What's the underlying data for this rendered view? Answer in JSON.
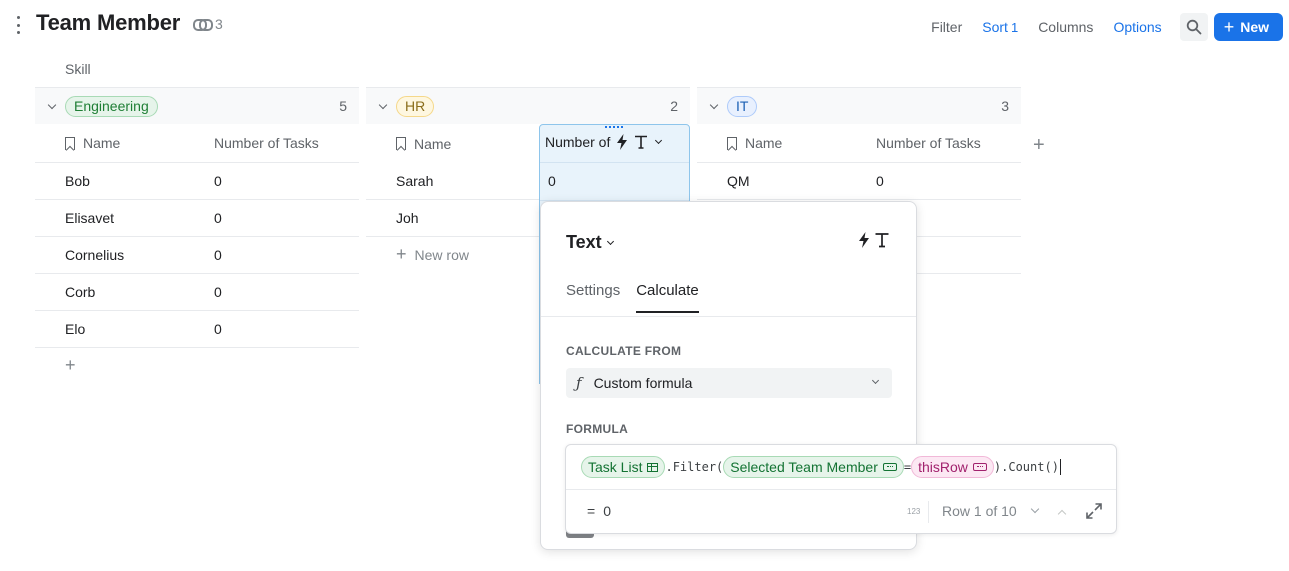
{
  "header": {
    "title": "Team Member",
    "link_count": "3",
    "filter_label": "Filter",
    "sort_label": "Sort",
    "sort_count": "1",
    "columns_label": "Columns",
    "options_label": "Options",
    "new_label": "New"
  },
  "group_by_label": "Skill",
  "groups": [
    {
      "name": "Engineering",
      "count": "5",
      "columns": [
        "Name",
        "Number of Tasks"
      ],
      "rows": [
        {
          "name": "Bob",
          "tasks": "0"
        },
        {
          "name": "Elisavet",
          "tasks": "0"
        },
        {
          "name": "Cornelius",
          "tasks": "0"
        },
        {
          "name": "Corb",
          "tasks": "0"
        },
        {
          "name": "Elo",
          "tasks": "0"
        }
      ]
    },
    {
      "name": "HR",
      "count": "2",
      "columns": [
        "Name",
        "Number of"
      ],
      "rows": [
        {
          "name": "Sarah",
          "tasks": "0"
        },
        {
          "name": "Joh",
          "tasks": ""
        }
      ],
      "new_row_label": "New row"
    },
    {
      "name": "IT",
      "count": "3",
      "columns": [
        "Name",
        "Number of Tasks"
      ],
      "rows": [
        {
          "name": "QM",
          "tasks": "0"
        }
      ]
    }
  ],
  "popover": {
    "type_label": "Text",
    "tabs": [
      "Settings",
      "Calculate"
    ],
    "active_tab": "Calculate",
    "calculate_from_label": "CALCULATE FROM",
    "calculate_from_value": "Custom formula",
    "fx_symbol": "ƒ",
    "formula_label": "FORMULA"
  },
  "formula": {
    "chip_table": "Task List",
    "method_filter": ".Filter(",
    "chip_column": "Selected Team Member",
    "equals": "=",
    "chip_this_row": "thisRow",
    "method_count": ").Count()",
    "result_prefix": "=",
    "result_value": "0",
    "type_badge": "123",
    "row_nav": "Row 1 of 10"
  },
  "colors": {
    "accent": "#1a73e8",
    "selected_column_bg": "#e8f3fb",
    "chip_green": "#e6f4ea",
    "chip_pink": "#fce8f3"
  }
}
